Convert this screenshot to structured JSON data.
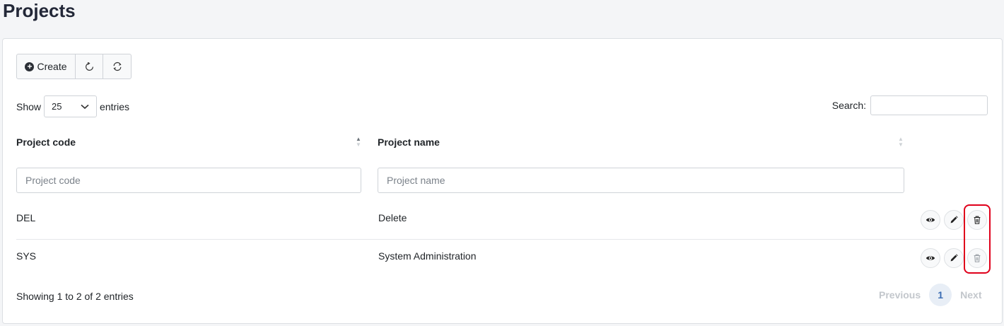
{
  "page": {
    "title": "Projects"
  },
  "toolbar": {
    "create_label": "Create",
    "reload_icon": "reload-icon",
    "refresh_icon": "refresh-icon"
  },
  "length_menu": {
    "show_label": "Show",
    "selected": "25",
    "entries_label": "entries"
  },
  "search": {
    "label": "Search:",
    "value": ""
  },
  "table": {
    "columns": [
      {
        "label": "Project code",
        "filter_placeholder": "Project code"
      },
      {
        "label": "Project name",
        "filter_placeholder": "Project name"
      }
    ],
    "rows": [
      {
        "code": "DEL",
        "name": "Delete"
      },
      {
        "code": "SYS",
        "name": "System Administration"
      }
    ]
  },
  "footer": {
    "info": "Showing 1 to 2 of 2 entries"
  },
  "pagination": {
    "previous": "Previous",
    "current": "1",
    "next": "Next"
  },
  "colors": {
    "highlight": "#e0001b",
    "accent": "#3a6cb3"
  }
}
